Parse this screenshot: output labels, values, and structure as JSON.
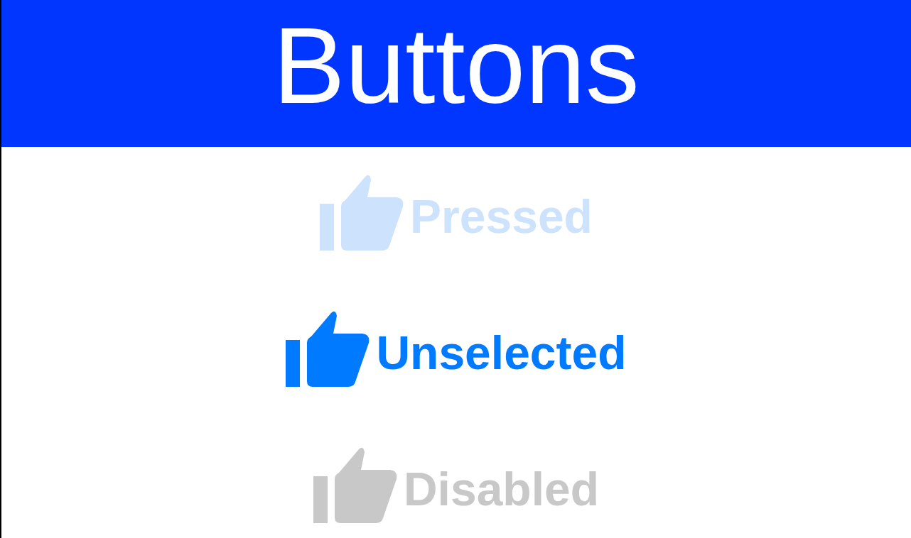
{
  "header": {
    "title": "Buttons"
  },
  "buttons": [
    {
      "label": "Pressed",
      "pressed": true,
      "disabled": false
    },
    {
      "label": "Unselected",
      "pressed": false,
      "disabled": false
    },
    {
      "label": "Disabled",
      "pressed": false,
      "disabled": true
    }
  ]
}
